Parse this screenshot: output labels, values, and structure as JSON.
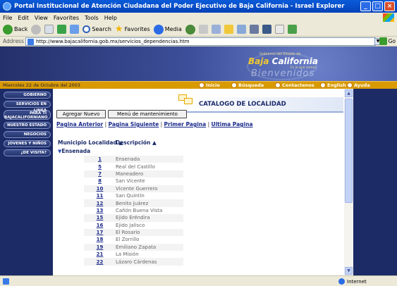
{
  "window": {
    "title": "Portal Institucional de Atención Ciudadana del Poder Ejecutivo de Baja California - Israel Explorer"
  },
  "menu": [
    "File",
    "Edit",
    "View",
    "Favorites",
    "Tools",
    "Help"
  ],
  "toolbar": {
    "back": "Back",
    "search": "Search",
    "favorites": "Favorites",
    "media": "Media"
  },
  "address": {
    "label": "Address",
    "url": "http://www.bajacalifornia.gob.mx/servicios_dependencias.htm",
    "go": "Go"
  },
  "banner": {
    "line1": "Gobierno del Estado de",
    "brand_a": "Baja",
    "brand_b": "California",
    "line3": "Es lo que somos",
    "welcome": "Bienvenidos"
  },
  "navbar": {
    "date": "Miercoles 22 de Octubre del 2003",
    "items": [
      "Inicio",
      "Búsqueda",
      "Contactenos",
      "English",
      "Ayuda"
    ]
  },
  "sidebar": {
    "items": [
      "GOBIERNO",
      "SERVICIOS EN LINEA",
      "PARA TI BAJACALIFORNIANO",
      "NUESTRO ESTADO",
      "NEGOCIOS",
      "JOVENES Y NIÑOS",
      "¿DE VISITA?"
    ]
  },
  "main": {
    "title": "CATALOGO DE LOCALIDAD",
    "add_button": "Agregar Nuevo",
    "menu_button": "Menú de mantenimiento",
    "links": [
      "Pagina Anterior",
      "Pagina Siguiente",
      "Primer Pagina",
      "Ultima Pagina"
    ],
    "col1": "Municipio Localidad ▲",
    "col2": "Descripción ▲",
    "group": "Ensenada",
    "rows": [
      {
        "num": "1",
        "desc": "Ensenada"
      },
      {
        "num": "5",
        "desc": "Real del Castillo"
      },
      {
        "num": "7",
        "desc": "Maneadero"
      },
      {
        "num": "8",
        "desc": "San Vicente"
      },
      {
        "num": "10",
        "desc": "Vicente Guerrero"
      },
      {
        "num": "11",
        "desc": "San Quintín"
      },
      {
        "num": "12",
        "desc": "Benito Juárez"
      },
      {
        "num": "13",
        "desc": "Cañón Buena Vista"
      },
      {
        "num": "15",
        "desc": "Ejido Eréndira"
      },
      {
        "num": "16",
        "desc": "Ejido Jalisco"
      },
      {
        "num": "17",
        "desc": "El Rosario"
      },
      {
        "num": "18",
        "desc": "El Zorrillo"
      },
      {
        "num": "19",
        "desc": "Emiliano Zapata"
      },
      {
        "num": "21",
        "desc": "La Misión"
      },
      {
        "num": "22",
        "desc": "Lázaro Cárdenas"
      }
    ]
  },
  "status": {
    "zone": "Internet"
  }
}
